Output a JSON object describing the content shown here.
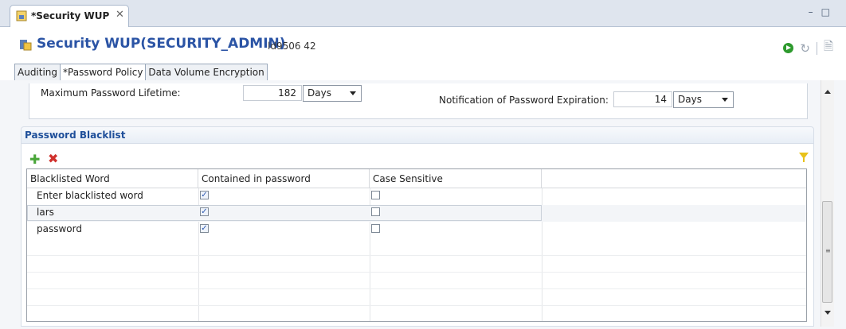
{
  "editor_tab": {
    "title": "*Security WUP",
    "close": "✕"
  },
  "window_controls": {
    "minimize": "–",
    "maximize": "□"
  },
  "header": {
    "title": "Security WUP(SECURITY_ADMIN)",
    "system": "ld9506 42"
  },
  "subtabs": [
    "Auditing",
    "*Password Policy",
    "Data Volume Encryption"
  ],
  "policy": {
    "max_lifetime_label": "Maximum Password Lifetime:",
    "max_lifetime_value": "182",
    "max_lifetime_unit": "Days",
    "notification_label": "Notification of Password Expiration:",
    "notification_value": "14",
    "notification_unit": "Days"
  },
  "blacklist": {
    "section_title": "Password Blacklist",
    "columns": [
      "Blacklisted Word",
      "Contained in password",
      "Case Sensitive"
    ],
    "rows": [
      {
        "word": "Enter blacklisted word",
        "contained": true,
        "case_sensitive": false
      },
      {
        "word": "lars",
        "contained": true,
        "case_sensitive": false
      },
      {
        "word": "password",
        "contained": true,
        "case_sensitive": false
      }
    ],
    "selected_row": 1
  },
  "icons": {
    "add": "plus-icon",
    "delete": "delete-icon",
    "filter": "filter-icon",
    "run": "run-icon"
  },
  "colors": {
    "title": "#2b54a5",
    "section_title": "#1f4f9a",
    "add": "#4aa63a",
    "delete": "#d0312d"
  }
}
